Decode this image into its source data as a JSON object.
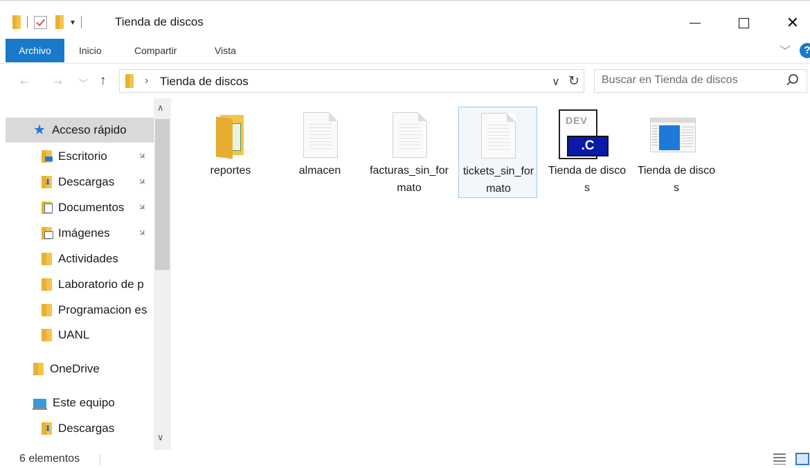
{
  "window": {
    "title": "Tienda de discos",
    "close_glyph": "✕"
  },
  "quick_access_toolbar": {
    "dropdown_glyph": "▾"
  },
  "ribbon": {
    "tabs": [
      {
        "label": "Archivo",
        "active": true
      },
      {
        "label": "Inicio"
      },
      {
        "label": "Compartir"
      },
      {
        "label": "Vista"
      }
    ],
    "collapse_glyph": "﹀",
    "help_glyph": "?"
  },
  "navigation": {
    "back_glyph": "←",
    "forward_glyph": "→",
    "recent_glyph": "﹀",
    "up_glyph": "↑"
  },
  "address_bar": {
    "separator_glyph": "›",
    "path": "Tienda de discos",
    "dropdown_glyph": "∨",
    "refresh_glyph": "↻"
  },
  "search": {
    "placeholder": "Buscar en Tienda de discos"
  },
  "sidebar": {
    "quick_access_label": "Acceso rápido",
    "items": [
      {
        "label": "Escritorio",
        "icon": "desktop-folder-icon",
        "pinned": true
      },
      {
        "label": "Descargas",
        "icon": "downloads-folder-icon",
        "pinned": true
      },
      {
        "label": "Documentos",
        "icon": "documents-folder-icon",
        "pinned": true
      },
      {
        "label": "Imágenes",
        "icon": "pictures-folder-icon",
        "pinned": true
      },
      {
        "label": "Actividades",
        "icon": "folder-icon",
        "pinned": false
      },
      {
        "label": "Laboratorio de p",
        "icon": "folder-icon",
        "pinned": false
      },
      {
        "label": "Programacion es",
        "icon": "folder-icon",
        "pinned": false
      },
      {
        "label": "UANL",
        "icon": "folder-icon",
        "pinned": false
      }
    ],
    "onedrive_label": "OneDrive",
    "this_pc_label": "Este equipo",
    "this_pc_items": [
      {
        "label": "Descargas",
        "icon": "downloads-folder-icon"
      }
    ],
    "pin_glyph": "✈",
    "scroll_up_glyph": "∧",
    "scroll_down_glyph": "∨"
  },
  "files": [
    {
      "name": "reportes",
      "type": "folder"
    },
    {
      "name": "almacen",
      "type": "file"
    },
    {
      "name": "facturas_sin_formato",
      "type": "file"
    },
    {
      "name": "tickets_sin_formato",
      "type": "file",
      "selected": true
    },
    {
      "name": "Tienda de discos",
      "type": "devcpp-project",
      "badge": ".C",
      "badge_text": "DEV"
    },
    {
      "name": "Tienda de discos",
      "type": "executable"
    }
  ],
  "status_bar": {
    "item_count": "6 elementos"
  },
  "colors": {
    "accent": "#1979ca",
    "folder": "#f3c44c",
    "selection_border": "#9bc8ef",
    "selection_fill": "#f2f7fc"
  }
}
